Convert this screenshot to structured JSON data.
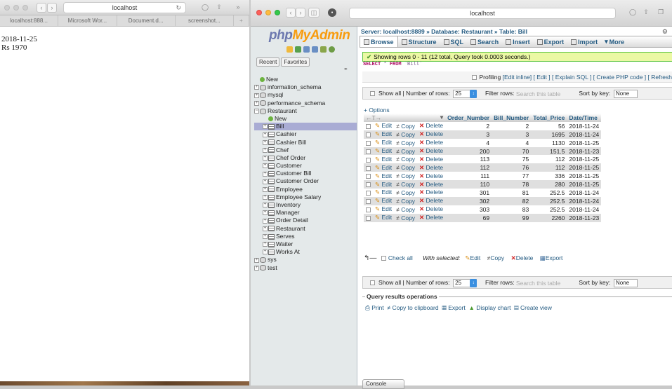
{
  "left_browser": {
    "address": "localhost",
    "tabs": [
      "localhost:888...",
      "Microsoft Wor...",
      "Document.d...",
      "screenshot..."
    ],
    "content_lines": [
      "2018-11-25",
      "Rs 1970"
    ]
  },
  "right_browser": {
    "address": "localhost"
  },
  "sidebar": {
    "logo_php": "php",
    "logo_myadmin": "MyAdmin",
    "tabs": [
      "Recent",
      "Favorites"
    ],
    "tree": [
      {
        "label": "New",
        "level": 0,
        "icon": "new"
      },
      {
        "label": "information_schema",
        "level": 0,
        "icon": "db"
      },
      {
        "label": "mysql",
        "level": 0,
        "icon": "db"
      },
      {
        "label": "performance_schema",
        "level": 0,
        "icon": "db"
      },
      {
        "label": "Restaurant",
        "level": 0,
        "icon": "db"
      },
      {
        "label": "New",
        "level": 1,
        "icon": "new"
      },
      {
        "label": "Bill",
        "level": 1,
        "icon": "tb",
        "selected": true
      },
      {
        "label": "Cashier",
        "level": 1,
        "icon": "tb"
      },
      {
        "label": "Cashier Bill",
        "level": 1,
        "icon": "tb"
      },
      {
        "label": "Chef",
        "level": 1,
        "icon": "tb"
      },
      {
        "label": "Chef Order",
        "level": 1,
        "icon": "tb"
      },
      {
        "label": "Customer",
        "level": 1,
        "icon": "tb"
      },
      {
        "label": "Customer Bill",
        "level": 1,
        "icon": "tb"
      },
      {
        "label": "Customer Order",
        "level": 1,
        "icon": "tb"
      },
      {
        "label": "Employee",
        "level": 1,
        "icon": "tb"
      },
      {
        "label": "Employee Salary",
        "level": 1,
        "icon": "tb"
      },
      {
        "label": "Inventory",
        "level": 1,
        "icon": "tb"
      },
      {
        "label": "Manager",
        "level": 1,
        "icon": "tb"
      },
      {
        "label": "Order Detail",
        "level": 1,
        "icon": "tb"
      },
      {
        "label": "Restaurant",
        "level": 1,
        "icon": "tb"
      },
      {
        "label": "Serves",
        "level": 1,
        "icon": "tb"
      },
      {
        "label": "Waiter",
        "level": 1,
        "icon": "tb"
      },
      {
        "label": "Works At",
        "level": 1,
        "icon": "tb"
      },
      {
        "label": "sys",
        "level": 0,
        "icon": "db"
      },
      {
        "label": "test",
        "level": 0,
        "icon": "db"
      }
    ]
  },
  "breadcrumb": {
    "server": "Server: localhost:8889",
    "sep": " » ",
    "database": "Database: Restaurant",
    "table": "Table: Bill"
  },
  "menu": [
    "Browse",
    "Structure",
    "SQL",
    "Search",
    "Insert",
    "Export",
    "Import",
    "More"
  ],
  "success_message": "Showing rows 0 - 11 (12 total, Query took 0.0003 seconds.)",
  "sql": {
    "keyword1": "SELECT",
    "star": " * ",
    "keyword2": "FROM",
    "table": " `Bill`"
  },
  "profiling": {
    "label": "Profiling",
    "links": "[Edit inline] [ Edit ] [ Explain SQL ] [ Create PHP code ] [ Refresh"
  },
  "navigation": {
    "show_all": "Show all",
    "sep": " | ",
    "rows_label": "Number of rows:",
    "rows_value": "25",
    "filter_label": "Filter rows:",
    "filter_placeholder": "Search this table",
    "sort_label": "Sort by key:",
    "sort_value": "None"
  },
  "options_label": "+ Options",
  "columns": [
    "Order_Number",
    "Bill_Number",
    "Total_Price",
    "Date/Time"
  ],
  "row_actions": {
    "edit": "Edit",
    "copy": "Copy",
    "delete": "Delete"
  },
  "rows": [
    [
      "2",
      "2",
      "56",
      "2018-11-24"
    ],
    [
      "3",
      "3",
      "1695",
      "2018-11-24"
    ],
    [
      "4",
      "4",
      "1130",
      "2018-11-25"
    ],
    [
      "200",
      "70",
      "151.5",
      "2018-11-23"
    ],
    [
      "113",
      "75",
      "112",
      "2018-11-25"
    ],
    [
      "112",
      "76",
      "112",
      "2018-11-25"
    ],
    [
      "111",
      "77",
      "336",
      "2018-11-25"
    ],
    [
      "110",
      "78",
      "280",
      "2018-11-25"
    ],
    [
      "301",
      "81",
      "252.5",
      "2018-11-24"
    ],
    [
      "302",
      "82",
      "252.5",
      "2018-11-24"
    ],
    [
      "303",
      "83",
      "252.5",
      "2018-11-24"
    ],
    [
      "69",
      "99",
      "2260",
      "2018-11-23"
    ]
  ],
  "with_selected": {
    "check_all": "Check all",
    "label": "With selected:",
    "edit": "Edit",
    "copy": "Copy",
    "delete": "Delete",
    "export": "Export"
  },
  "query_results": {
    "legend": "Query results operations",
    "print": "Print",
    "copy_clipboard": "Copy to clipboard",
    "export": "Export",
    "display_chart": "Display chart",
    "create_view": "Create view"
  },
  "console_label": "Console"
}
